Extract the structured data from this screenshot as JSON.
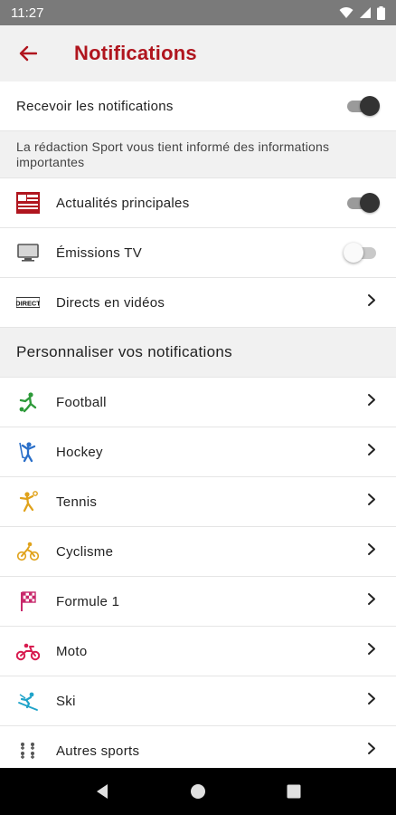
{
  "status_bar": {
    "time": "11:27"
  },
  "header": {
    "title": "Notifications"
  },
  "master": {
    "label": "Recevoir les notifications",
    "enabled": true
  },
  "info_text": "La rédaction Sport vous tient informé des informations importantes",
  "general": [
    {
      "label": "Actualités principales",
      "icon": "brand-logo-icon",
      "control": "toggle",
      "enabled": true
    },
    {
      "label": "Émissions TV",
      "icon": "tv-icon",
      "control": "toggle",
      "enabled": false
    },
    {
      "label": "Directs en vidéos",
      "icon": "direct-logo-icon",
      "icon_text": "DIRECT",
      "control": "chevron"
    }
  ],
  "section_title": "Personnaliser vos notifications",
  "sports": [
    {
      "label": "Football",
      "icon": "football-icon",
      "color": "#2e9a3a"
    },
    {
      "label": "Hockey",
      "icon": "hockey-icon",
      "color": "#2a6fc9"
    },
    {
      "label": "Tennis",
      "icon": "tennis-icon",
      "color": "#e0a21a"
    },
    {
      "label": "Cyclisme",
      "icon": "cycling-icon",
      "color": "#e0a21a"
    },
    {
      "label": "Formule 1",
      "icon": "racing-flag-icon",
      "color": "#c8286b"
    },
    {
      "label": "Moto",
      "icon": "motorbike-icon",
      "color": "#d81b4f"
    },
    {
      "label": "Ski",
      "icon": "ski-icon",
      "color": "#1fa3c9"
    },
    {
      "label": "Autres sports",
      "icon": "other-sports-icon",
      "color": "#555555"
    }
  ],
  "colors": {
    "accent": "#b0151e",
    "header_bg": "#f1f1f1",
    "status_bar": "#7a7a7a"
  }
}
